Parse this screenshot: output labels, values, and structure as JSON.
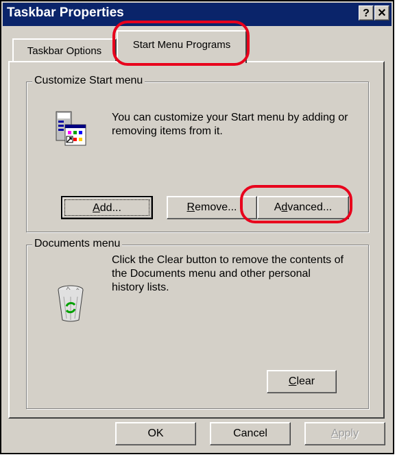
{
  "window": {
    "title": "Taskbar Properties",
    "help_glyph": "?",
    "close_glyph": "✕"
  },
  "tabs": [
    {
      "label": "Taskbar Options",
      "active": false
    },
    {
      "label": "Start Menu Programs",
      "active": true
    }
  ],
  "customize_group": {
    "legend": "Customize Start menu",
    "description": "You can customize your Start menu by adding or removing items from it.",
    "icon": "start-menu-icon",
    "buttons": {
      "add": {
        "mnemonic": "A",
        "rest": "dd..."
      },
      "remove": {
        "mnemonic": "R",
        "rest": "emove..."
      },
      "advanced": {
        "before": "A",
        "mnemonic": "d",
        "rest": "vanced..."
      }
    }
  },
  "documents_group": {
    "legend": "Documents menu",
    "description": "Click the Clear button to remove the contents of the Documents menu and other personal history lists.",
    "icon": "recycle-bin-icon",
    "clear_button": {
      "mnemonic": "C",
      "rest": "lear"
    }
  },
  "footer": {
    "ok": "OK",
    "cancel": "Cancel",
    "apply": {
      "mnemonic": "A",
      "rest": "pply"
    }
  },
  "colors": {
    "title_bar": "#0a246a",
    "face": "#d4d0c8",
    "annotation": "#e8001c"
  }
}
